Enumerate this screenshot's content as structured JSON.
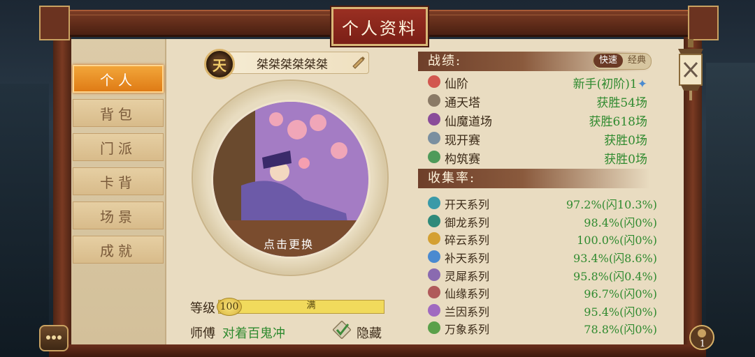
{
  "title": "个人资料",
  "tabs": [
    {
      "label": "个人",
      "active": true
    },
    {
      "label": "背包",
      "active": false
    },
    {
      "label": "门派",
      "active": false
    },
    {
      "label": "卡背",
      "active": false
    },
    {
      "label": "场景",
      "active": false
    },
    {
      "label": "成就",
      "active": false
    }
  ],
  "profile": {
    "badge": "天",
    "name": "桀桀桀桀桀桀",
    "portrait_caption": "点击更换",
    "level_label": "等级",
    "level": "100",
    "level_full": "满",
    "level_progress": 1.0,
    "master_label": "师傅",
    "master_name": "对着百鬼冲",
    "hide_label": "隐藏",
    "hide_checked": true
  },
  "stats": {
    "heading": "战绩:",
    "toggle_fast": "快速",
    "toggle_classic": "经典",
    "rows": [
      {
        "label": "仙阶",
        "value": "新手(初阶)1",
        "icon": "star-icon",
        "color": "#d2574f"
      },
      {
        "label": "通天塔",
        "value": "获胜54场",
        "icon": "tower-icon",
        "color": "#8a7a66"
      },
      {
        "label": "仙魔道场",
        "value": "获胜618场",
        "icon": "arena-icon",
        "color": "#8a4c9a"
      },
      {
        "label": "现开赛",
        "value": "获胜0场",
        "icon": "face-icon",
        "color": "#7a8fa0"
      },
      {
        "label": "构筑赛",
        "value": "获胜0场",
        "icon": "build-icon",
        "color": "#4f9a5a"
      }
    ]
  },
  "collection": {
    "heading": "收集率:",
    "rows": [
      {
        "label": "开天系列",
        "value": "97.2%(闪10.3%)",
        "icon": "kaitian-icon",
        "color": "#3a9aa8"
      },
      {
        "label": "御龙系列",
        "value": "98.4%(闪0%)",
        "icon": "dragon-icon",
        "color": "#2f8a7a"
      },
      {
        "label": "碎云系列",
        "value": "100.0%(闪0%)",
        "icon": "cloud-icon",
        "color": "#d4a032"
      },
      {
        "label": "补天系列",
        "value": "93.4%(闪8.6%)",
        "icon": "sky-icon",
        "color": "#4a8ad0"
      },
      {
        "label": "灵犀系列",
        "value": "95.8%(闪0.4%)",
        "icon": "spirit-icon",
        "color": "#8a6ab0"
      },
      {
        "label": "仙缘系列",
        "value": "96.7%(闪0%)",
        "icon": "fate-icon",
        "color": "#b05a5a"
      },
      {
        "label": "兰因系列",
        "value": "95.4%(闪0%)",
        "icon": "orchid-icon",
        "color": "#a06ac0"
      },
      {
        "label": "万象系列",
        "value": "78.8%(闪0%)",
        "icon": "myriad-icon",
        "color": "#5aa04a"
      }
    ]
  },
  "bag_count": "1"
}
